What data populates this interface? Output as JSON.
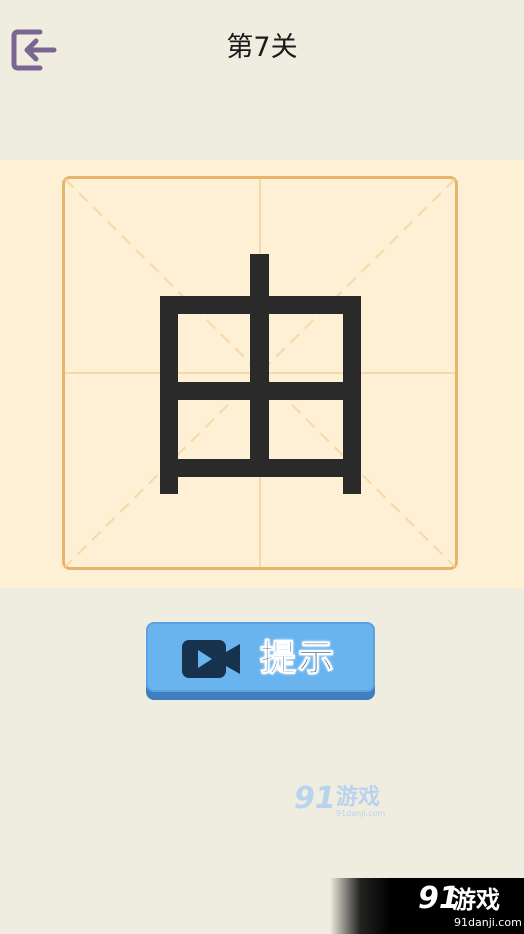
{
  "header": {
    "title": "第7关",
    "back_icon": "exit-arrow-icon"
  },
  "puzzle": {
    "character": "由",
    "grid_style": "mi-zi-ge",
    "colors": {
      "band": "#fdf0d4",
      "border": "#e6b46b",
      "guide_lines": "#f5d9a8",
      "stroke": "#2a2a2a"
    }
  },
  "hint_button": {
    "label": "提示",
    "icon": "video-camera-icon",
    "color": "#69b4ee"
  },
  "watermark": {
    "number": "91",
    "text": "游戏",
    "url": "91danji.com"
  },
  "corner_logo": {
    "number": "91",
    "text": "游戏",
    "url": "91danji.com"
  }
}
